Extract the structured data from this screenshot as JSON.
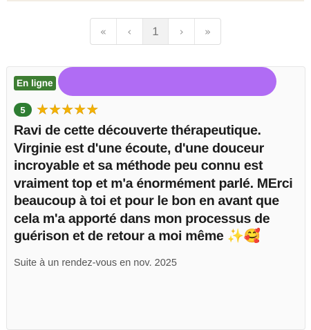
{
  "pagination": {
    "first": "«",
    "prev": "‹",
    "current": "1",
    "next": "›",
    "last": "»"
  },
  "review": {
    "status_badge": "En ligne",
    "separator": "-",
    "rating": "5",
    "stars": 5,
    "text": "Ravi de cette découverte thérapeutique. Virginie est d'une écoute, d'une douceur incroyable et sa méthode peu connu est vraiment top et m'a énormément parlé. MErci beaucoup à toi et pour le bon en avant que cela m'a apporté dans mon processus de guérison et de retour a moi même ✨🥰",
    "visit_note": "Suite à un rendez-vous en nov. 2025"
  },
  "colors": {
    "online_badge": "#3d7d32",
    "rating_badge": "#2e7d32",
    "star": "#f5b301",
    "redaction": "#b06cf4"
  }
}
